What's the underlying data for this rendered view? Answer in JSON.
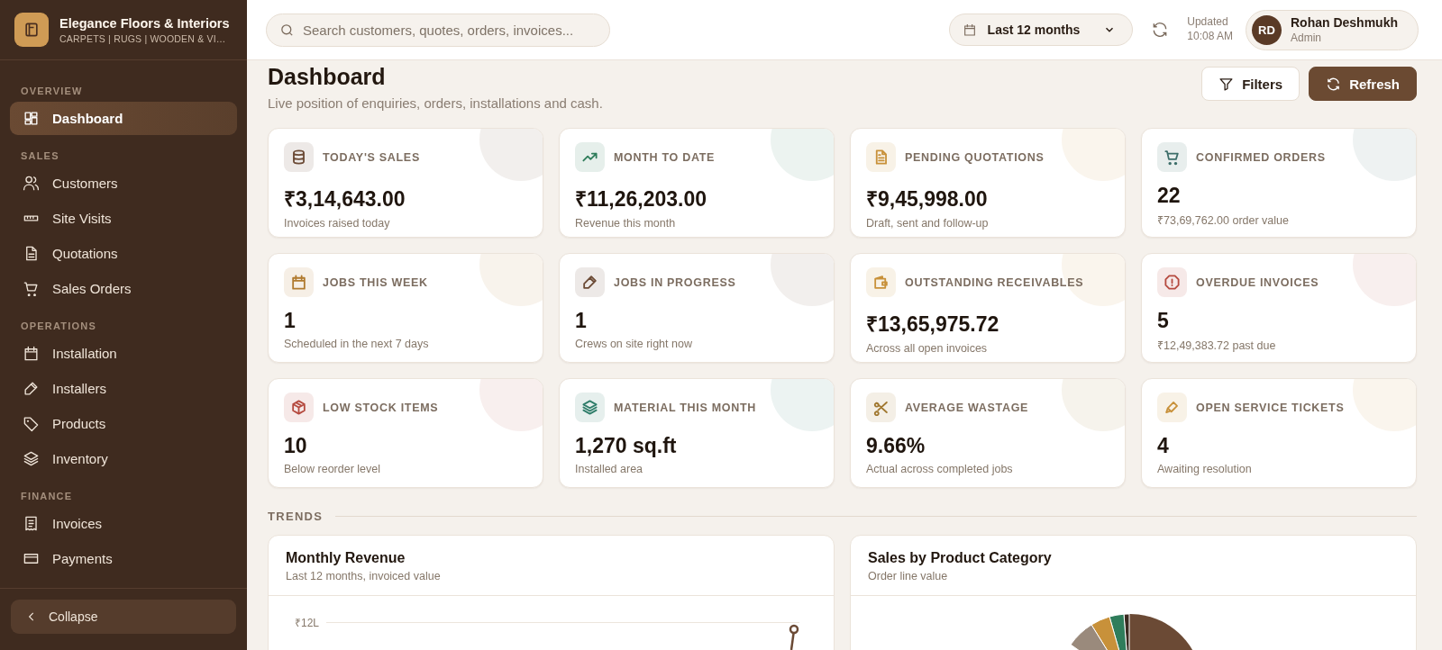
{
  "brand": {
    "name": "Elegance Floors & Interiors",
    "tagline": "CARPETS | RUGS | WOODEN & VI…"
  },
  "sidebar": {
    "sections": [
      {
        "title": "OVERVIEW",
        "items": [
          {
            "label": "Dashboard",
            "selected": true
          }
        ]
      },
      {
        "title": "SALES",
        "items": [
          {
            "label": "Customers",
            "selected": false
          },
          {
            "label": "Site Visits",
            "selected": false
          },
          {
            "label": "Quotations",
            "selected": false
          },
          {
            "label": "Sales Orders",
            "selected": false
          }
        ]
      },
      {
        "title": "OPERATIONS",
        "items": [
          {
            "label": "Installation",
            "selected": false
          },
          {
            "label": "Installers",
            "selected": false
          },
          {
            "label": "Products",
            "selected": false
          },
          {
            "label": "Inventory",
            "selected": false
          }
        ]
      },
      {
        "title": "FINANCE",
        "items": [
          {
            "label": "Invoices",
            "selected": false
          },
          {
            "label": "Payments",
            "selected": false
          }
        ]
      }
    ],
    "collapse": "Collapse"
  },
  "topbar": {
    "search": {
      "placeholder": "Search customers, quotes, orders, invoices..."
    },
    "period": "Last 12 months",
    "updated_label": "Updated",
    "updated_time": "10:08 AM",
    "user": {
      "initials": "RD",
      "name": "Rohan Deshmukh",
      "role": "Admin"
    }
  },
  "page": {
    "title": "Dashboard",
    "subtitle": "Live position of enquiries, orders, installations and cash.",
    "buttons": [
      "Filters",
      "Refresh"
    ]
  },
  "cards": [
    {
      "label": "TODAY'S SALES",
      "value": "₹3,14,643.00",
      "note": "Invoices raised today",
      "color": "#6b4a35"
    },
    {
      "label": "MONTH TO DATE",
      "value": "₹11,26,203.00",
      "note": "Revenue this month",
      "color": "#2f7d5b"
    },
    {
      "label": "PENDING QUOTATIONS",
      "value": "₹9,45,998.00",
      "note": "Draft, sent and follow-up",
      "color": "#c8913a"
    },
    {
      "label": "CONFIRMED ORDERS",
      "value": "22",
      "note": "₹73,69,762.00 order value",
      "color": "#3d6e6a"
    },
    {
      "label": "JOBS THIS WEEK",
      "value": "1",
      "note": "Scheduled in the next 7 days",
      "color": "#b07a2e"
    },
    {
      "label": "JOBS IN PROGRESS",
      "value": "1",
      "note": "Crews on site right now",
      "color": "#6b4a35"
    },
    {
      "label": "OUTSTANDING RECEIVABLES",
      "value": "₹13,65,975.72",
      "note": "Across all open invoices",
      "color": "#c8913a"
    },
    {
      "label": "OVERDUE INVOICES",
      "value": "5",
      "note": "₹12,49,383.72 past due",
      "color": "#b54a3f"
    },
    {
      "label": "LOW STOCK ITEMS",
      "value": "10",
      "note": "Below reorder level",
      "color": "#b54a3f"
    },
    {
      "label": "MATERIAL THIS MONTH",
      "value": "1,270 sq.ft",
      "note": "Installed area",
      "color": "#2f7d6a"
    },
    {
      "label": "AVERAGE WASTAGE",
      "value": "9.66%",
      "note": "Actual across completed jobs",
      "color": "#a0772f"
    },
    {
      "label": "OPEN SERVICE TICKETS",
      "value": "4",
      "note": "Awaiting resolution",
      "color": "#c8913a"
    }
  ],
  "trends": {
    "title": "TRENDS",
    "panels": [
      {
        "kind": "line",
        "title": "Monthly Revenue",
        "subtitle": "Last 12 months, invoiced value",
        "tick_label": "₹12L"
      },
      {
        "kind": "pie",
        "title": "Sales by Product Category",
        "subtitle": "Order line value"
      }
    ]
  }
}
